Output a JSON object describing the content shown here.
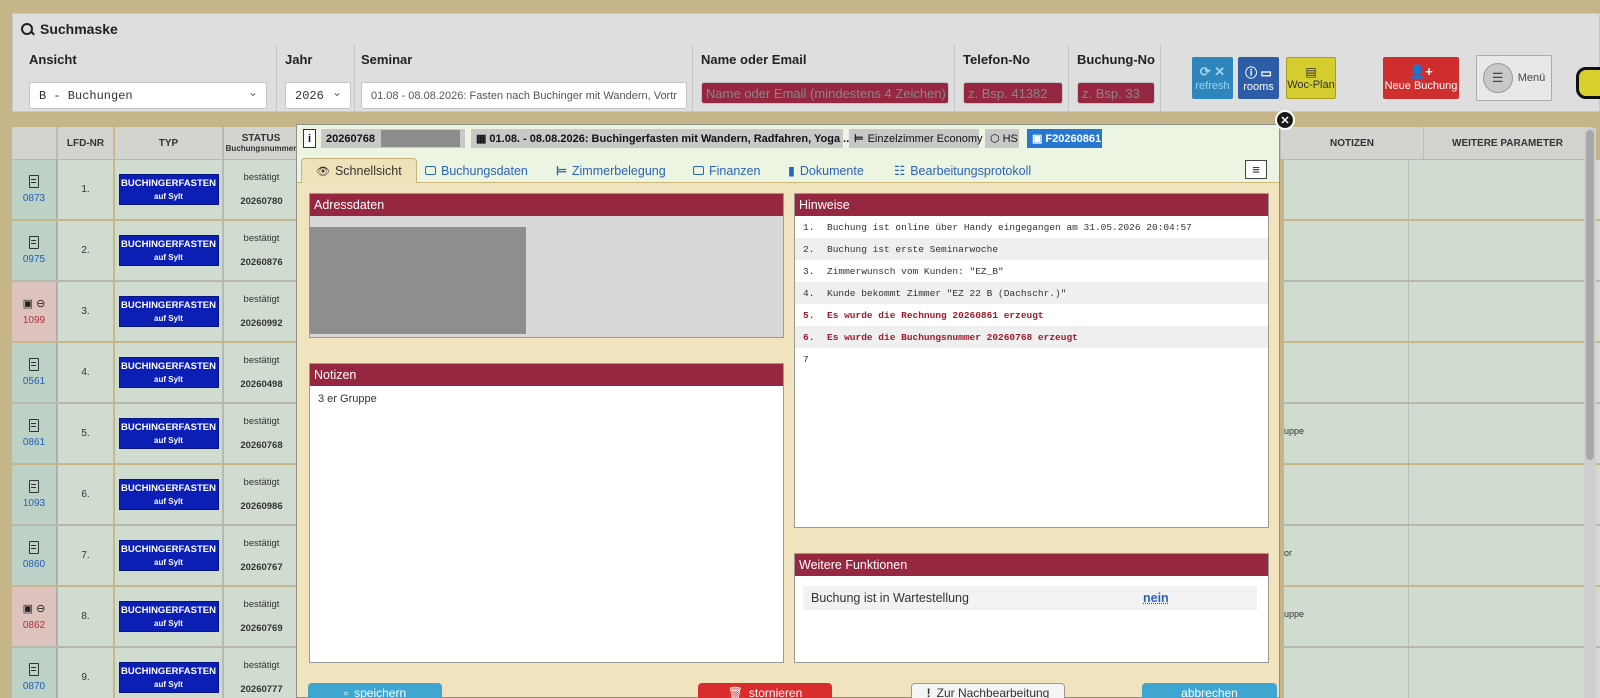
{
  "search": {
    "title": "Suchmaske",
    "ansicht": {
      "label": "Ansicht",
      "value": "B - Buchungen"
    },
    "jahr": {
      "label": "Jahr",
      "value": "2026"
    },
    "seminar": {
      "label": "Seminar",
      "value": "01.08 - 08.08.2026: Fasten nach Buchinger mit Wandern, Vortr"
    },
    "name": {
      "label": "Name oder Email",
      "placeholder": "Name oder Email (mindestens 4 Zeichen)"
    },
    "telefon": {
      "label": "Telefon-No",
      "placeholder": "z. Bsp. 41382"
    },
    "buchung": {
      "label": "Buchung-No",
      "placeholder": "z. Bsp. 33"
    },
    "buttons": {
      "refresh": "refresh",
      "rooms": "rooms",
      "woc_plan": "Woc-Plan",
      "neue_buchung": "Neue Buchung",
      "menu": "Menü"
    }
  },
  "table": {
    "headers": {
      "lfd": "LFD-NR",
      "typ": "TYP",
      "status": "STATUS",
      "status_sub": "Buchungsnummer",
      "notizen": "NOTIZEN",
      "weitere": "WEITERE PARAMETER"
    },
    "rows": [
      {
        "nr": "1.",
        "code": "0873",
        "typ": "BUCHINGERFASTEN",
        "sub": "auf Sylt",
        "status": "bestätigt",
        "num": "20260780",
        "note": ""
      },
      {
        "nr": "2.",
        "code": "0975",
        "typ": "BUCHINGERFASTEN",
        "sub": "auf Sylt",
        "status": "bestätigt",
        "num": "20260876",
        "note": ""
      },
      {
        "nr": "3.",
        "code": "1099",
        "typ": "BUCHINGERFASTEN",
        "sub": "auf Sylt",
        "status": "bestätigt",
        "num": "20260992",
        "note": ""
      },
      {
        "nr": "4.",
        "code": "0561",
        "typ": "BUCHINGERFASTEN",
        "sub": "auf Sylt",
        "status": "bestätigt",
        "num": "20260498",
        "note": ""
      },
      {
        "nr": "5.",
        "code": "0861",
        "typ": "BUCHINGERFASTEN",
        "sub": "auf Sylt",
        "status": "bestätigt",
        "num": "20260768",
        "note": "uppe"
      },
      {
        "nr": "6.",
        "code": "1093",
        "typ": "BUCHINGERFASTEN",
        "sub": "auf Sylt",
        "status": "bestätigt",
        "num": "20260986",
        "note": ""
      },
      {
        "nr": "7.",
        "code": "0860",
        "typ": "BUCHINGERFASTEN",
        "sub": "auf Sylt",
        "status": "bestätigt",
        "num": "20260767",
        "note": "or"
      },
      {
        "nr": "8.",
        "code": "0862",
        "typ": "BUCHINGERFASTEN",
        "sub": "auf Sylt",
        "status": "bestätigt",
        "num": "20260769",
        "note": "uppe"
      },
      {
        "nr": "9.",
        "code": "0870",
        "typ": "BUCHINGERFASTEN",
        "sub": "auf Sylt",
        "status": "bestätigt",
        "num": "20260777",
        "note": ""
      }
    ]
  },
  "modal": {
    "info_glyph": "i",
    "booking_no": "20260768",
    "seminar": "01.08. - 08.08.2026: Buchingerfasten mit Wandern, Radfahren, Yoga ...",
    "room": "Einzelzimmer Economy",
    "season": "HS",
    "invoice": "F20260861",
    "tabs": [
      "Schnellsicht",
      "Buchungsdaten",
      "Zimmerbelegung",
      "Finanzen",
      "Dokumente",
      "Bearbeitungsprotokoll"
    ],
    "adressdaten": {
      "title": "Adressdaten"
    },
    "notizen": {
      "title": "Notizen",
      "text": "3 er Gruppe"
    },
    "hinweise": {
      "title": "Hinweise",
      "items": [
        {
          "n": "1.",
          "text": "Buchung ist online über Handy eingegangen am 31.05.2026 20:04:57"
        },
        {
          "n": "2.",
          "text": "Buchung ist erste Seminarwoche"
        },
        {
          "n": "3.",
          "text": "Zimmerwunsch vom Kunden: \"EZ_B\""
        },
        {
          "n": "4.",
          "text": "Kunde bekommt Zimmer \"EZ 22 B (Dachschr.)\""
        },
        {
          "n": "5.",
          "text": "Es wurde die Rechnung 20260861 erzeugt"
        },
        {
          "n": "6.",
          "text": "Es wurde die Buchungsnummer 20260768 erzeugt"
        },
        {
          "n": "7",
          "text": ""
        }
      ]
    },
    "weitere": {
      "title": "Weitere Funktionen",
      "label": "Buchung ist in Wartestellung",
      "value": "nein"
    },
    "footer": {
      "speichern": "speichern",
      "stornieren": "stornieren",
      "nachbearbeitung": "Zur Nachbearbeitung",
      "abbrechen": "abbrechen"
    }
  }
}
